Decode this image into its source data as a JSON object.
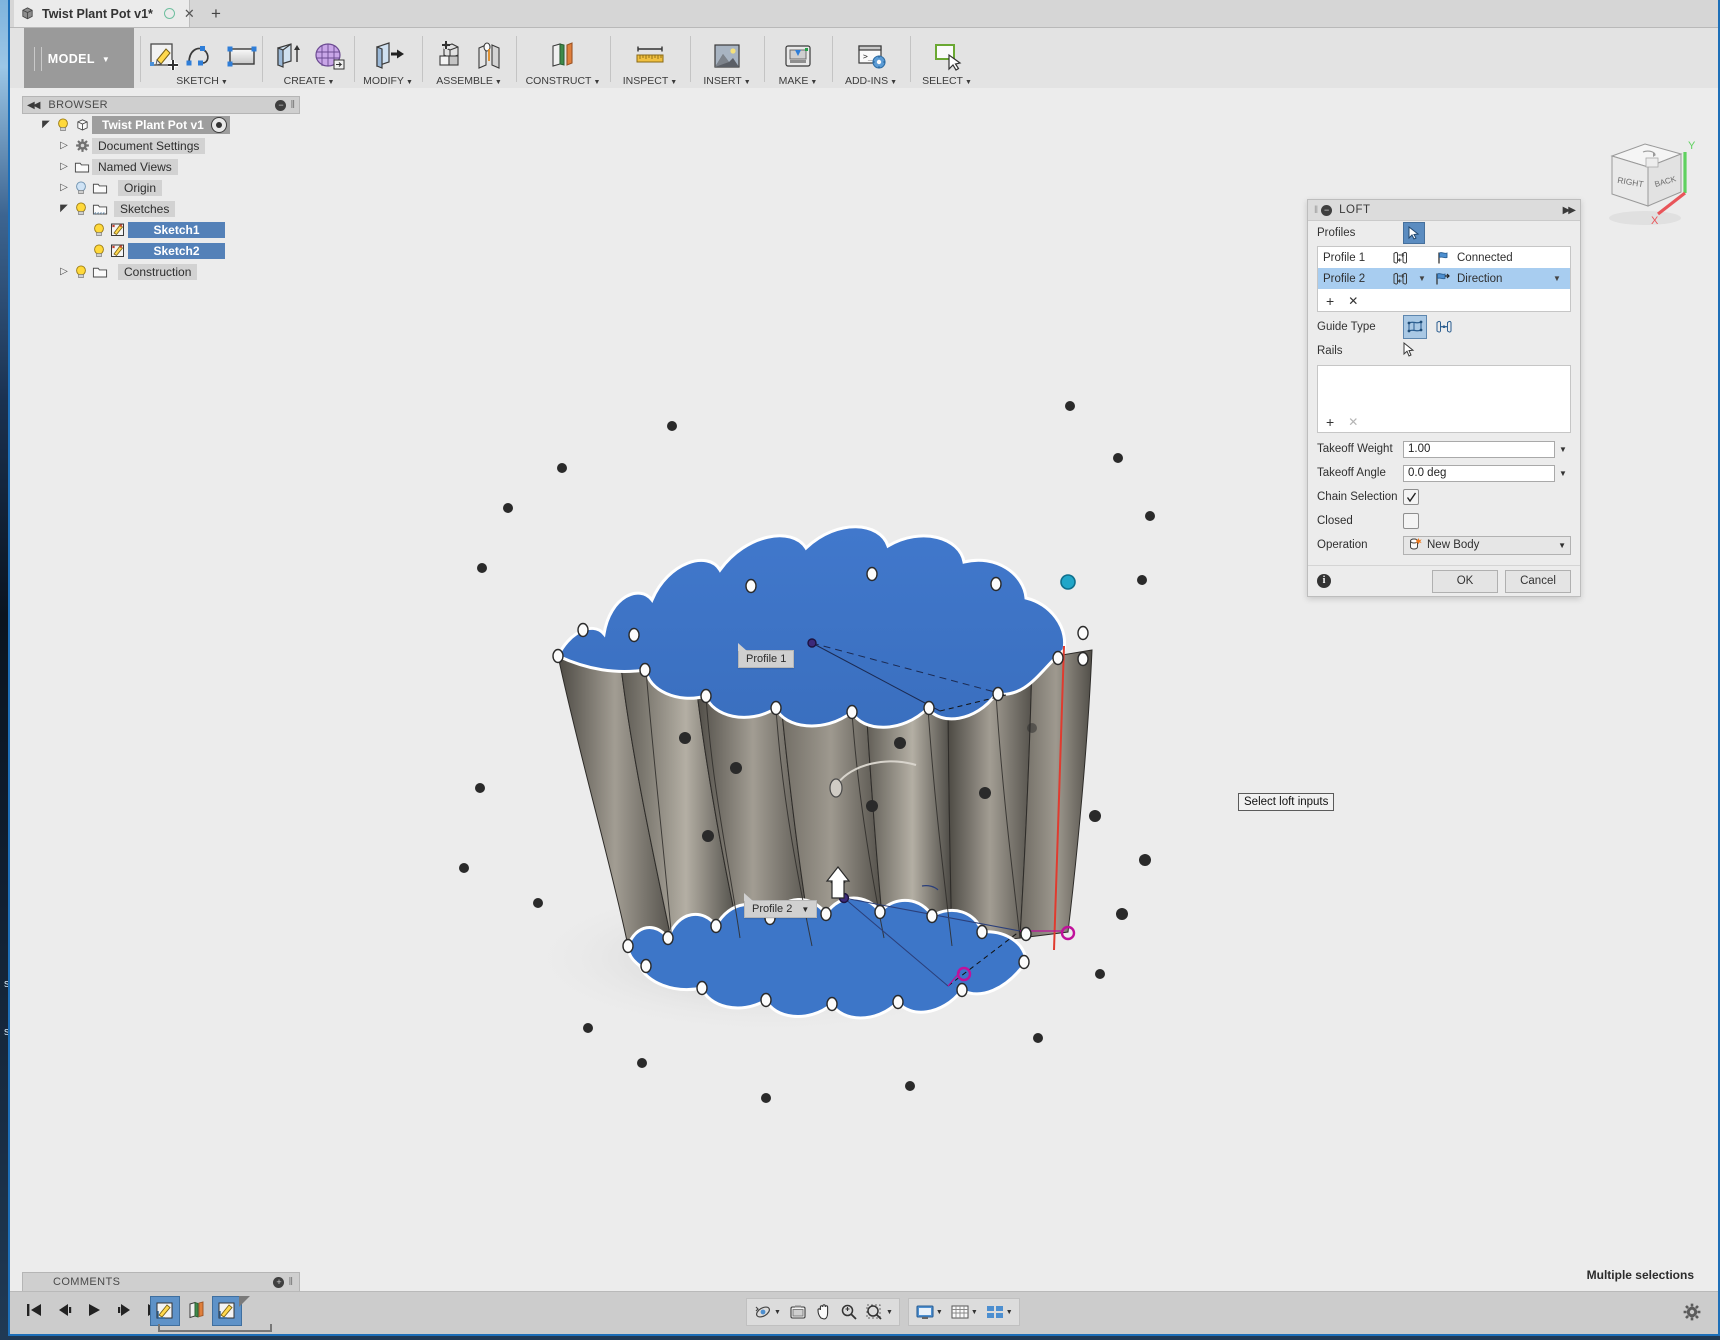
{
  "window": {
    "tab_title": "Twist Plant Pot v1*",
    "new_tab_label": "+",
    "close_label": "✕"
  },
  "ribbon": {
    "mode_label": "MODEL",
    "groups": [
      {
        "label": "SKETCH",
        "icons": [
          "create-sketch-icon",
          "spline-icon",
          "rectangle-icon"
        ]
      },
      {
        "label": "CREATE",
        "icons": [
          "extrude-icon",
          "create-form-icon"
        ]
      },
      {
        "label": "MODIFY",
        "icons": [
          "press-pull-icon"
        ]
      },
      {
        "label": "ASSEMBLE",
        "icons": [
          "new-component-icon",
          "joint-icon"
        ]
      },
      {
        "label": "CONSTRUCT",
        "icons": [
          "offset-plane-icon"
        ]
      },
      {
        "label": "INSPECT",
        "icons": [
          "measure-icon"
        ]
      },
      {
        "label": "INSERT",
        "icons": [
          "insert-image-icon"
        ]
      },
      {
        "label": "MAKE",
        "icons": [
          "3d-print-icon"
        ]
      },
      {
        "label": "ADD-INS",
        "icons": [
          "scripts-addins-icon"
        ]
      },
      {
        "label": "SELECT",
        "icons": [
          "select-window-icon"
        ]
      }
    ]
  },
  "browser": {
    "title": "BROWSER",
    "root": "Twist Plant Pot v1",
    "items": [
      {
        "label": "Document Settings",
        "icon": "gear-icon",
        "bulb": false,
        "expand": "closed",
        "selected": false
      },
      {
        "label": "Named Views",
        "icon": "folder-icon",
        "bulb": false,
        "expand": "closed",
        "selected": false
      },
      {
        "label": "Origin",
        "icon": "folder-icon",
        "bulb": true,
        "expand": "closed",
        "selected": false
      },
      {
        "label": "Sketches",
        "icon": "sketches-folder-icon",
        "bulb": true,
        "expand": "open",
        "selected": false
      },
      {
        "label": "Sketch1",
        "icon": "sketch-icon",
        "bulb": true,
        "expand": "none",
        "selected": true
      },
      {
        "label": "Sketch2",
        "icon": "sketch-icon",
        "bulb": true,
        "expand": "none",
        "selected": true
      },
      {
        "label": "Construction",
        "icon": "folder-icon",
        "bulb": true,
        "expand": "closed",
        "selected": false
      }
    ]
  },
  "loft": {
    "title": "LOFT",
    "profiles_label": "Profiles",
    "profiles": [
      {
        "name": "Profile 1",
        "condition": "Connected",
        "selected": false,
        "has_caret": false
      },
      {
        "name": "Profile 2",
        "condition": "Direction",
        "selected": true,
        "has_caret": true
      }
    ],
    "profile_add": "+",
    "profile_remove": "✕",
    "guide_type_label": "Guide Type",
    "guide_type_options": [
      "rails-icon",
      "centerline-icon"
    ],
    "guide_type_selected": 0,
    "rails_label": "Rails",
    "rails_add": "+",
    "rails_remove": "✕",
    "takeoff_weight_label": "Takeoff Weight",
    "takeoff_weight_value": "1.00",
    "takeoff_angle_label": "Takeoff Angle",
    "takeoff_angle_value": "0.0 deg",
    "chain_selection_label": "Chain Selection",
    "chain_selection_checked": true,
    "closed_label": "Closed",
    "closed_checked": false,
    "operation_label": "Operation",
    "operation_value": "New Body",
    "ok_label": "OK",
    "cancel_label": "Cancel"
  },
  "canvas": {
    "profile1_label": "Profile 1",
    "profile2_label": "Profile 2",
    "tooltip": "Select loft inputs",
    "viewcube": {
      "face_left": "RIGHT",
      "face_right": "BACK",
      "axis_x": "X",
      "axis_y": "Y"
    },
    "colors": {
      "profile_blue": "#3d76c8",
      "body_gray": "#7e7a70",
      "rail_red": "#e03b2f",
      "point_cyan": "#21a6c8",
      "point_magenta": "#c0119b",
      "axis_x": "#e8555a",
      "axis_y": "#5fd15f"
    }
  },
  "comments": {
    "title": "COMMENTS",
    "add": "+"
  },
  "status": {
    "message": "Multiple selections"
  },
  "bottom": {
    "timeline_buttons": [
      "go-to-start-icon",
      "step-back-icon",
      "play-icon",
      "step-forward-icon",
      "go-to-end-icon"
    ],
    "timeline_features": [
      "sketch1-feature-icon",
      "plane-feature-icon",
      "sketch2-feature-icon"
    ],
    "nav_buttons": [
      "orbit-icon",
      "look-at-icon",
      "pan-icon",
      "zoom-icon",
      "fit-icon"
    ],
    "display_buttons": [
      "display-settings-icon",
      "grid-snap-icon",
      "viewports-icon"
    ],
    "settings_icon": "gear-icon"
  }
}
